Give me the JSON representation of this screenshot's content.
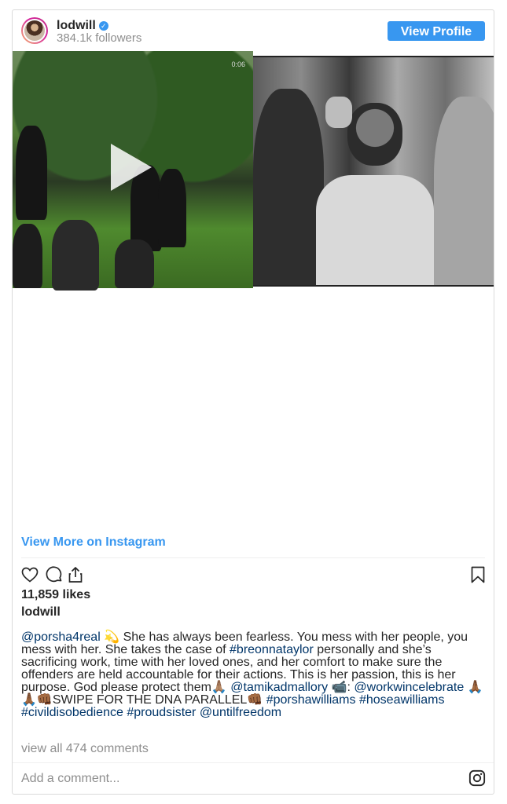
{
  "header": {
    "username": "lodwill",
    "verified_glyph": "✓",
    "followers": "384.1k followers",
    "view_profile_label": "View Profile"
  },
  "media": {
    "video_timer": "0:06",
    "left_icon": "play-icon"
  },
  "view_more_label": "View More on Instagram",
  "actions": {
    "icons": [
      "heart-icon",
      "comment-icon",
      "share-icon",
      "bookmark-icon"
    ]
  },
  "likes": "11,859 likes",
  "owner": "lodwill",
  "caption": {
    "mention1": "@porsha4real",
    "text1": " 💫 She has always been fearless. You mess with her people, you mess with her. She takes the case of ",
    "tag1": "#breonnataylor",
    "text2": " personally and she’s sacrificing work, time with her loved ones, and her comfort to make sure the offenders are held accountable for their actions. This is her passion, this is her purpose. God please protect them🙏🏽 ",
    "mention2": "@tamikadmallory",
    "text3": " 📹: ",
    "mention3": "@workwincelebrate",
    "text4": " 🙏🏾🙏🏾👊🏾SWIPE FOR THE DNA PARALLEL👊🏾 ",
    "tag2": "#porshawilliams",
    "tag3": "#hoseawilliams",
    "tag4": "#civildisobedience",
    "tag5": "#proudsister",
    "mention4": "@untilfreedom"
  },
  "view_comments": "view all 474 comments",
  "add_comment_placeholder": "Add a comment...",
  "colors": {
    "accent": "#3897f0",
    "link": "#003569",
    "muted": "#8e8e8e",
    "text": "#262626",
    "border": "#dbdbdb"
  }
}
